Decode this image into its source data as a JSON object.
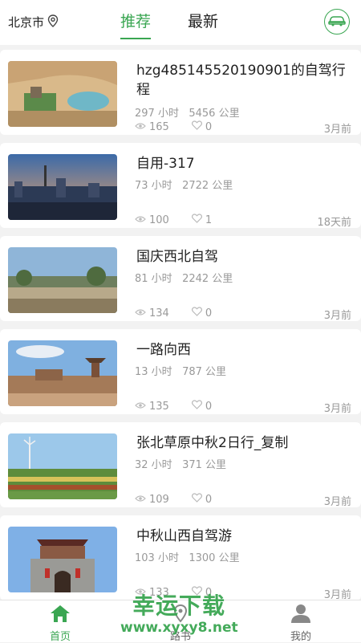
{
  "header": {
    "city": "北京市",
    "tabs": [
      "推荐",
      "最新"
    ],
    "active_tab": "推荐",
    "accent_color": "#3aa652",
    "right_icon": "car-icon"
  },
  "trips": [
    {
      "title": "hzg485145520190901的自驾行程",
      "hours": "297 小时",
      "km": "5456 公里",
      "views": "165",
      "likes": "0",
      "date": "3月前"
    },
    {
      "title": "自用-317",
      "hours": "73 小时",
      "km": "2722 公里",
      "views": "100",
      "likes": "1",
      "date": "18天前"
    },
    {
      "title": "国庆西北自驾",
      "hours": "81 小时",
      "km": "2242 公里",
      "views": "134",
      "likes": "0",
      "date": "3月前"
    },
    {
      "title": "一路向西",
      "hours": "13 小时",
      "km": "787 公里",
      "views": "135",
      "likes": "0",
      "date": "3月前"
    },
    {
      "title": "张北草原中秋2日行_复制",
      "hours": "32 小时",
      "km": "371 公里",
      "views": "109",
      "likes": "0",
      "date": "3月前"
    },
    {
      "title": "中秋山西自驾游",
      "hours": "103 小时",
      "km": "1300 公里",
      "views": "133",
      "likes": "0",
      "date": "3月前"
    }
  ],
  "bottom_nav": {
    "home": "首页",
    "route": "路书",
    "me": "我的"
  },
  "watermark": {
    "line1": "幸运下载",
    "line2": "www.xyxy8.net"
  }
}
